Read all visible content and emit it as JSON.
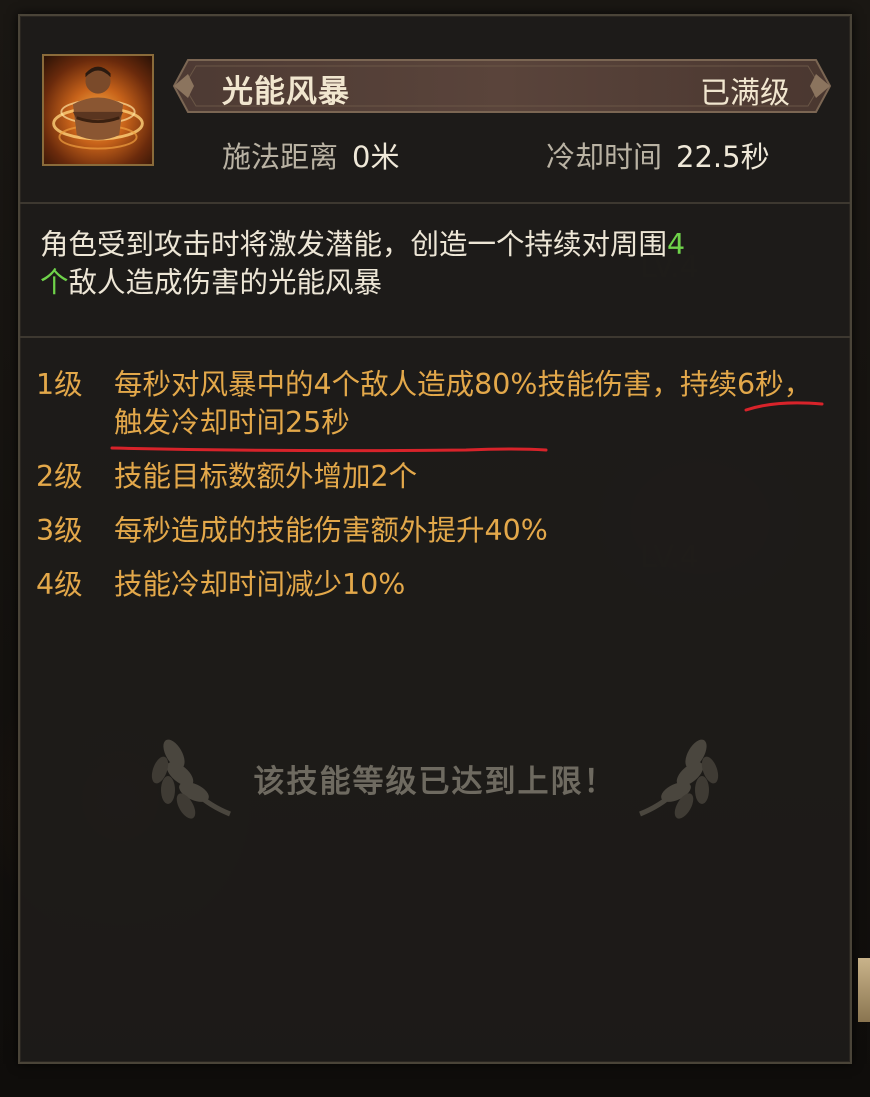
{
  "skill": {
    "name": "光能风暴",
    "max_level_badge": "已满级",
    "icon": "storm-fighter-icon",
    "stats": {
      "range_label": "施法距离",
      "range_value": "0米",
      "cooldown_label": "冷却时间",
      "cooldown_value": "22.5秒"
    },
    "description": {
      "part1": "角色受到攻击时将激发潜能，创造一个持续对周围",
      "highlight_a": "4",
      "highlight_b": "个",
      "part2": "敌人造成伤害的光能风暴",
      "highlight_color": "#6fd34a"
    },
    "levels": [
      {
        "level": "1级",
        "text": "每秒对风暴中的4个敌人造成80%技能伤害，持续6秒，触发冷却时间25秒"
      },
      {
        "level": "2级",
        "text": "技能目标数额外增加2个"
      },
      {
        "level": "3级",
        "text": "每秒造成的技能伤害额外提升40%"
      },
      {
        "level": "4级",
        "text": "技能冷却时间减少10%"
      }
    ],
    "level_text_color": "#e3a84a",
    "max_message": "该技能等级已达到上限！"
  },
  "annotation": {
    "underline_color": "#d8232a"
  }
}
